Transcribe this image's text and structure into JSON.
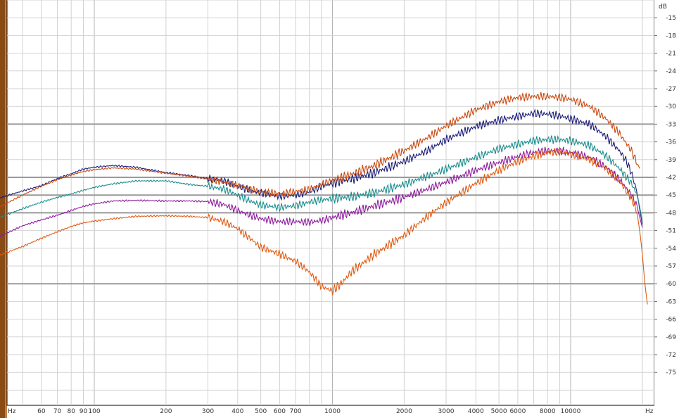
{
  "chart_data": {
    "type": "line",
    "title": "",
    "x_axis": {
      "scale": "log",
      "range": [
        40,
        20000
      ],
      "unit_label_left": "Hz",
      "unit_label_right": "Hz",
      "ticks": [
        {
          "value": 60,
          "label": "60"
        },
        {
          "value": 70,
          "label": "70"
        },
        {
          "value": 80,
          "label": "80"
        },
        {
          "value": 90,
          "label": "90"
        },
        {
          "value": 100,
          "label": "100"
        },
        {
          "value": 200,
          "label": "200"
        },
        {
          "value": 300,
          "label": "300"
        },
        {
          "value": 400,
          "label": "400"
        },
        {
          "value": 500,
          "label": "500"
        },
        {
          "value": 600,
          "label": "600"
        },
        {
          "value": 700,
          "label": "700"
        },
        {
          "value": 1000,
          "label": "1000"
        },
        {
          "value": 2000,
          "label": "2000"
        },
        {
          "value": 3000,
          "label": "3000"
        },
        {
          "value": 4000,
          "label": "4000"
        },
        {
          "value": 5000,
          "label": "5000"
        },
        {
          "value": 6000,
          "label": "6000"
        },
        {
          "value": 8000,
          "label": "8000"
        },
        {
          "value": 10000,
          "label": "10000"
        }
      ]
    },
    "y_axis": {
      "unit_label": "dB",
      "range": [
        -78,
        -12
      ],
      "ticks": [
        "-15",
        "-18",
        "-21",
        "-24",
        "-27",
        "-30",
        "-33",
        "-36",
        "-39",
        "-42",
        "-45",
        "-48",
        "-51",
        "-54",
        "-57",
        "-60",
        "-63",
        "-66",
        "-69",
        "-72",
        "-75"
      ]
    },
    "highlighted_gridlines_db": [
      -33,
      -42,
      -45,
      -48,
      -60
    ],
    "grid": true,
    "series": [
      {
        "color": "#1c1c78",
        "points": [
          [
            40,
            -45.5
          ],
          [
            50,
            -44.3
          ],
          [
            60,
            -43.4
          ],
          [
            70,
            -42.2
          ],
          [
            80,
            -41.4
          ],
          [
            90,
            -40.6
          ],
          [
            100,
            -40.3
          ],
          [
            120,
            -40.0
          ],
          [
            150,
            -40.3
          ],
          [
            200,
            -41.2
          ],
          [
            250,
            -41.7
          ],
          [
            300,
            -42.2
          ],
          [
            350,
            -42.6
          ],
          [
            400,
            -43.5
          ],
          [
            450,
            -44.2
          ],
          [
            500,
            -44.6
          ],
          [
            600,
            -45.2
          ],
          [
            700,
            -45.0
          ],
          [
            800,
            -44.5
          ],
          [
            900,
            -43.5
          ],
          [
            1000,
            -43.0
          ],
          [
            1200,
            -42.3
          ],
          [
            1500,
            -41.2
          ],
          [
            2000,
            -39.3
          ],
          [
            2500,
            -37.5
          ],
          [
            3000,
            -35.6
          ],
          [
            4000,
            -33.4
          ],
          [
            5000,
            -32.3
          ],
          [
            6000,
            -31.7
          ],
          [
            7000,
            -31.2
          ],
          [
            8000,
            -31.3
          ],
          [
            9000,
            -31.6
          ],
          [
            10000,
            -32.1
          ],
          [
            12000,
            -33.0
          ],
          [
            14000,
            -35.0
          ],
          [
            16000,
            -37.5
          ],
          [
            17000,
            -39.0
          ],
          [
            18000,
            -41.2
          ],
          [
            19000,
            -44.5
          ],
          [
            19500,
            -47.5
          ],
          [
            20000,
            -50.0
          ]
        ]
      },
      {
        "color": "#c84a10",
        "points": [
          [
            40,
            -47.0
          ],
          [
            50,
            -45.0
          ],
          [
            60,
            -43.5
          ],
          [
            70,
            -42.4
          ],
          [
            80,
            -41.6
          ],
          [
            90,
            -41.0
          ],
          [
            100,
            -40.7
          ],
          [
            120,
            -40.4
          ],
          [
            150,
            -40.6
          ],
          [
            200,
            -41.3
          ],
          [
            250,
            -41.8
          ],
          [
            300,
            -42.3
          ],
          [
            350,
            -42.8
          ],
          [
            400,
            -43.4
          ],
          [
            450,
            -44.0
          ],
          [
            500,
            -44.4
          ],
          [
            600,
            -44.8
          ],
          [
            700,
            -44.4
          ],
          [
            800,
            -44.0
          ],
          [
            900,
            -43.2
          ],
          [
            1000,
            -42.5
          ],
          [
            1200,
            -41.5
          ],
          [
            1500,
            -40.0
          ],
          [
            2000,
            -37.5
          ],
          [
            2500,
            -35.3
          ],
          [
            3000,
            -33.3
          ],
          [
            4000,
            -30.6
          ],
          [
            5000,
            -29.2
          ],
          [
            6000,
            -28.5
          ],
          [
            7000,
            -28.3
          ],
          [
            8000,
            -28.3
          ],
          [
            9000,
            -28.5
          ],
          [
            10000,
            -28.8
          ],
          [
            12000,
            -30.0
          ],
          [
            14000,
            -32.0
          ],
          [
            16000,
            -34.5
          ],
          [
            18000,
            -37.5
          ],
          [
            19500,
            -40.5
          ]
        ]
      },
      {
        "color": "#1c8c8c",
        "points": [
          [
            40,
            -48.8
          ],
          [
            50,
            -47.3
          ],
          [
            60,
            -46.2
          ],
          [
            70,
            -45.4
          ],
          [
            80,
            -44.8
          ],
          [
            90,
            -44.2
          ],
          [
            100,
            -43.7
          ],
          [
            120,
            -43.1
          ],
          [
            150,
            -42.6
          ],
          [
            200,
            -42.6
          ],
          [
            250,
            -43.2
          ],
          [
            300,
            -43.5
          ],
          [
            350,
            -44.0
          ],
          [
            400,
            -45.0
          ],
          [
            450,
            -46.0
          ],
          [
            500,
            -46.7
          ],
          [
            600,
            -47.1
          ],
          [
            700,
            -46.8
          ],
          [
            800,
            -46.2
          ],
          [
            900,
            -45.8
          ],
          [
            1000,
            -45.6
          ],
          [
            1200,
            -45.3
          ],
          [
            1500,
            -44.6
          ],
          [
            2000,
            -43.2
          ],
          [
            2500,
            -41.8
          ],
          [
            3000,
            -40.6
          ],
          [
            4000,
            -38.6
          ],
          [
            5000,
            -37.2
          ],
          [
            6000,
            -36.4
          ],
          [
            7000,
            -35.8
          ],
          [
            8000,
            -35.6
          ],
          [
            9000,
            -35.6
          ],
          [
            10000,
            -35.8
          ],
          [
            12000,
            -36.6
          ],
          [
            14000,
            -38.3
          ],
          [
            16000,
            -40.5
          ],
          [
            18000,
            -43.0
          ],
          [
            19000,
            -45.0
          ],
          [
            19500,
            -47.0
          ],
          [
            20000,
            -49.5
          ]
        ]
      },
      {
        "color": "#8c1c9c",
        "points": [
          [
            40,
            -52.0
          ],
          [
            50,
            -50.2
          ],
          [
            60,
            -49.2
          ],
          [
            70,
            -48.4
          ],
          [
            80,
            -47.6
          ],
          [
            90,
            -46.9
          ],
          [
            100,
            -46.5
          ],
          [
            120,
            -46.0
          ],
          [
            150,
            -45.9
          ],
          [
            200,
            -46.0
          ],
          [
            250,
            -46.0
          ],
          [
            300,
            -46.1
          ],
          [
            350,
            -46.6
          ],
          [
            400,
            -47.6
          ],
          [
            450,
            -48.4
          ],
          [
            500,
            -49.0
          ],
          [
            600,
            -49.5
          ],
          [
            700,
            -49.5
          ],
          [
            800,
            -49.6
          ],
          [
            900,
            -49.3
          ],
          [
            1000,
            -48.8
          ],
          [
            1200,
            -48.0
          ],
          [
            1500,
            -46.8
          ],
          [
            2000,
            -45.4
          ],
          [
            2500,
            -44.0
          ],
          [
            3000,
            -42.8
          ],
          [
            4000,
            -40.8
          ],
          [
            5000,
            -39.5
          ],
          [
            6000,
            -38.5
          ],
          [
            7000,
            -37.8
          ],
          [
            8000,
            -37.5
          ],
          [
            9000,
            -37.5
          ],
          [
            10000,
            -37.8
          ],
          [
            12000,
            -38.6
          ],
          [
            14000,
            -40.2
          ],
          [
            16000,
            -42.3
          ],
          [
            18000,
            -45.0
          ],
          [
            19000,
            -47.0
          ],
          [
            20000,
            -50.5
          ]
        ]
      },
      {
        "color": "#e05a10",
        "points": [
          [
            40,
            -55.2
          ],
          [
            50,
            -53.7
          ],
          [
            60,
            -52.3
          ],
          [
            70,
            -51.2
          ],
          [
            80,
            -50.3
          ],
          [
            90,
            -49.7
          ],
          [
            100,
            -49.4
          ],
          [
            120,
            -49.0
          ],
          [
            150,
            -48.6
          ],
          [
            200,
            -48.5
          ],
          [
            250,
            -48.6
          ],
          [
            300,
            -48.8
          ],
          [
            350,
            -49.5
          ],
          [
            400,
            -50.7
          ],
          [
            450,
            -52.3
          ],
          [
            500,
            -53.8
          ],
          [
            600,
            -55.0
          ],
          [
            700,
            -56.2
          ],
          [
            800,
            -58.0
          ],
          [
            900,
            -60.5
          ],
          [
            1000,
            -61.2
          ],
          [
            1100,
            -59.8
          ],
          [
            1200,
            -58.0
          ],
          [
            1500,
            -55.0
          ],
          [
            2000,
            -51.8
          ],
          [
            2500,
            -48.6
          ],
          [
            3000,
            -46.3
          ],
          [
            4000,
            -43.0
          ],
          [
            5000,
            -40.8
          ],
          [
            6000,
            -39.3
          ],
          [
            7000,
            -38.4
          ],
          [
            8000,
            -37.8
          ],
          [
            9000,
            -37.7
          ],
          [
            10000,
            -38.1
          ],
          [
            12000,
            -39.0
          ],
          [
            14000,
            -40.5
          ],
          [
            16000,
            -42.6
          ],
          [
            18000,
            -45.5
          ],
          [
            19000,
            -48.0
          ],
          [
            19500,
            -51.0
          ],
          [
            20000,
            -55.0
          ],
          [
            20500,
            -60.0
          ],
          [
            21000,
            -63.5
          ]
        ]
      }
    ]
  }
}
